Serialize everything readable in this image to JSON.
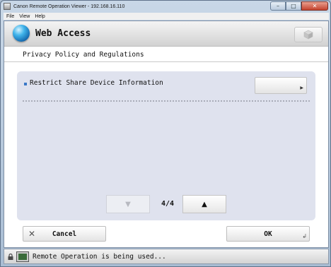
{
  "window": {
    "title": "Canon Remote Operation Viewer - 192.168.16.110",
    "controls": {
      "minimize": "–",
      "maximize": "□",
      "close": "✕"
    }
  },
  "menu": {
    "items": [
      "File",
      "View",
      "Help"
    ]
  },
  "header": {
    "title": "Web Access",
    "globe_icon": "globe-icon",
    "right_button_icon": "cube-icon"
  },
  "section": {
    "title": "Privacy Policy and Regulations"
  },
  "settings": {
    "items": [
      {
        "label": "Restrict Share Device Information",
        "button_value": ""
      }
    ]
  },
  "pager": {
    "down_symbol": "▼",
    "up_symbol": "▲",
    "count": "4/4"
  },
  "footer": {
    "cancel_label": "Cancel",
    "ok_label": "OK"
  },
  "status": {
    "text": "Remote Operation is being used..."
  },
  "colors": {
    "accent": "#3a78c7",
    "panel": "#dfe2ee"
  }
}
